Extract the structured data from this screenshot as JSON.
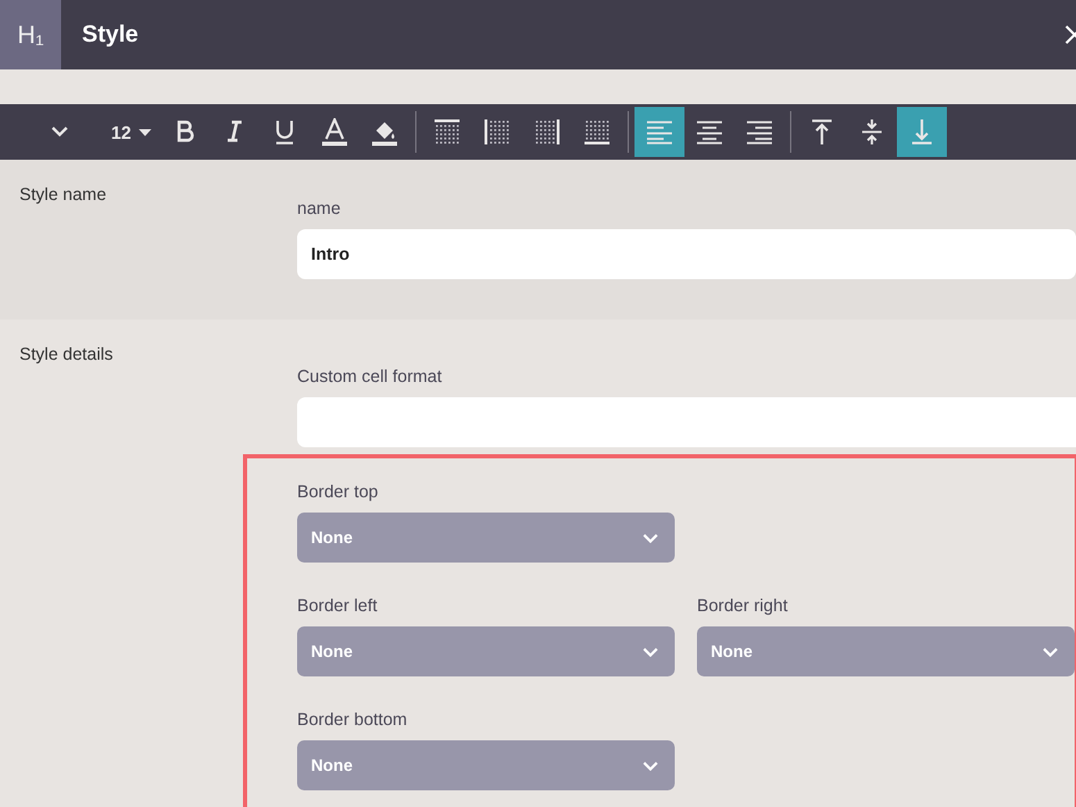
{
  "window": {
    "badge": "H₁",
    "title": "Style"
  },
  "toolbar": {
    "font_size": "12",
    "tools": [
      {
        "kind": "bold"
      },
      {
        "kind": "italic"
      },
      {
        "kind": "underline"
      },
      {
        "kind": "font-color"
      },
      {
        "kind": "fill-color"
      },
      {
        "kind": "sep"
      },
      {
        "kind": "border-top"
      },
      {
        "kind": "border-left"
      },
      {
        "kind": "border-right"
      },
      {
        "kind": "border-bottom"
      },
      {
        "kind": "sep"
      },
      {
        "kind": "align-left",
        "selected": true
      },
      {
        "kind": "align-center",
        "selected": false
      },
      {
        "kind": "align-right",
        "selected": false
      },
      {
        "kind": "sep"
      },
      {
        "kind": "valign-top",
        "selected": false
      },
      {
        "kind": "valign-middle",
        "selected": false
      },
      {
        "kind": "valign-bottom",
        "selected": true
      }
    ]
  },
  "style_name": {
    "heading": "Style name",
    "label": "name",
    "value": "Intro"
  },
  "style_details": {
    "heading": "Style details",
    "custom_format": {
      "label": "Custom cell format"
    },
    "borders": [
      {
        "label": "Border top",
        "value": "None"
      },
      {
        "label": "Border left",
        "value": "None"
      },
      {
        "label": "Border right",
        "value": "None"
      },
      {
        "label": "Border bottom",
        "value": "None"
      }
    ]
  }
}
